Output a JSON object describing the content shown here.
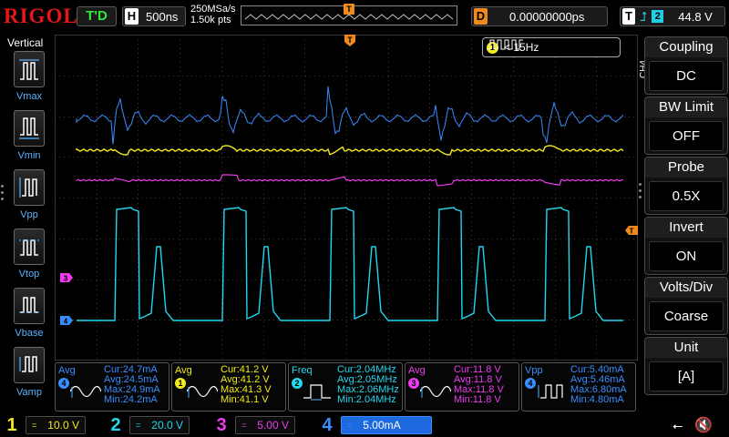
{
  "top": {
    "logo": "RIGOL",
    "run_status": "T'D",
    "timebase_badge": "H",
    "timebase": "500ns",
    "sample_rate": "250MSa/s",
    "memory_depth": "1.50k pts",
    "trigger_marker": "T",
    "delay_badge": "D",
    "delay": "0.00000000ps",
    "trigger_badge": "T",
    "trigger_edge_icon": "rising-edge-icon",
    "trigger_source": "2",
    "trigger_level": "44.8 V"
  },
  "left_menu": {
    "title": "Vertical",
    "items": [
      {
        "label": "Vmax",
        "icon": "vmax-icon"
      },
      {
        "label": "Vmin",
        "icon": "vmin-icon"
      },
      {
        "label": "Vpp",
        "icon": "vpp-icon"
      },
      {
        "label": "Vtop",
        "icon": "vtop-icon"
      },
      {
        "label": "Vbase",
        "icon": "vbase-icon"
      },
      {
        "label": "Vamp",
        "icon": "vamp-icon"
      }
    ]
  },
  "screen": {
    "freq_counter_badge": "1",
    "freq_counter": "< 15Hz",
    "trigger_pos_marker": "T",
    "trigger_level_marker": "T",
    "ch3_marker": "3",
    "ch4_marker": "4"
  },
  "right_menu": {
    "channel_tag": "CH4",
    "items": [
      {
        "name": "Coupling",
        "value": "DC"
      },
      {
        "name": "BW Limit",
        "value": "OFF"
      },
      {
        "name": "Probe",
        "value": "0.5X"
      },
      {
        "name": "Invert",
        "value": "ON"
      },
      {
        "name": "Volts/Div",
        "value": "Coarse"
      },
      {
        "name": "Unit",
        "value": "[A]"
      }
    ]
  },
  "measurements": [
    {
      "name": "Avg",
      "channel": "4",
      "color": "#3a8cff",
      "cur": "Cur:24.7mA",
      "avg": "Avg:24.5mA",
      "max": "Max:24.9mA",
      "min": "Min:24.2mA"
    },
    {
      "name": "Avg",
      "channel": "1",
      "color": "#f2ea1a",
      "cur": "Cur:41.2 V",
      "avg": "Avg:41.2 V",
      "max": "Max:41.3 V",
      "min": "Min:41.1 V"
    },
    {
      "name": "Freq",
      "channel": "2",
      "color": "#22d8ee",
      "cur": "Cur:2.04MHz",
      "avg": "Avg:2.05MHz",
      "max": "Max:2.06MHz",
      "min": "Min:2.04MHz"
    },
    {
      "name": "Avg",
      "channel": "3",
      "color": "#ec3cec",
      "cur": "Cur:11.8 V",
      "avg": "Avg:11.8 V",
      "max": "Max:11.8 V",
      "min": "Min:11.8 V"
    },
    {
      "name": "Vpp",
      "channel": "4",
      "color": "#3a8cff",
      "cur": "Cur:5.40mA",
      "avg": "Avg:5.46mA",
      "max": "Max:6.80mA",
      "min": "Min:4.80mA"
    }
  ],
  "channels": [
    {
      "num": "1",
      "scale": "10.0 V",
      "color": "#f2ea1a",
      "coupling": "="
    },
    {
      "num": "2",
      "scale": "20.0 V",
      "color": "#22d8ee",
      "coupling": "="
    },
    {
      "num": "3",
      "scale": "5.00 V",
      "color": "#ec3cec",
      "coupling": "="
    },
    {
      "num": "4",
      "scale": "5.00mA",
      "color": "#3a8cff",
      "coupling": "="
    }
  ],
  "colors": {
    "ch1": "#f2ea1a",
    "ch2": "#22d8ee",
    "ch3": "#ec3cec",
    "ch4": "#3a8cff",
    "trigger": "#f08a1c",
    "logo": "#e8161a"
  }
}
